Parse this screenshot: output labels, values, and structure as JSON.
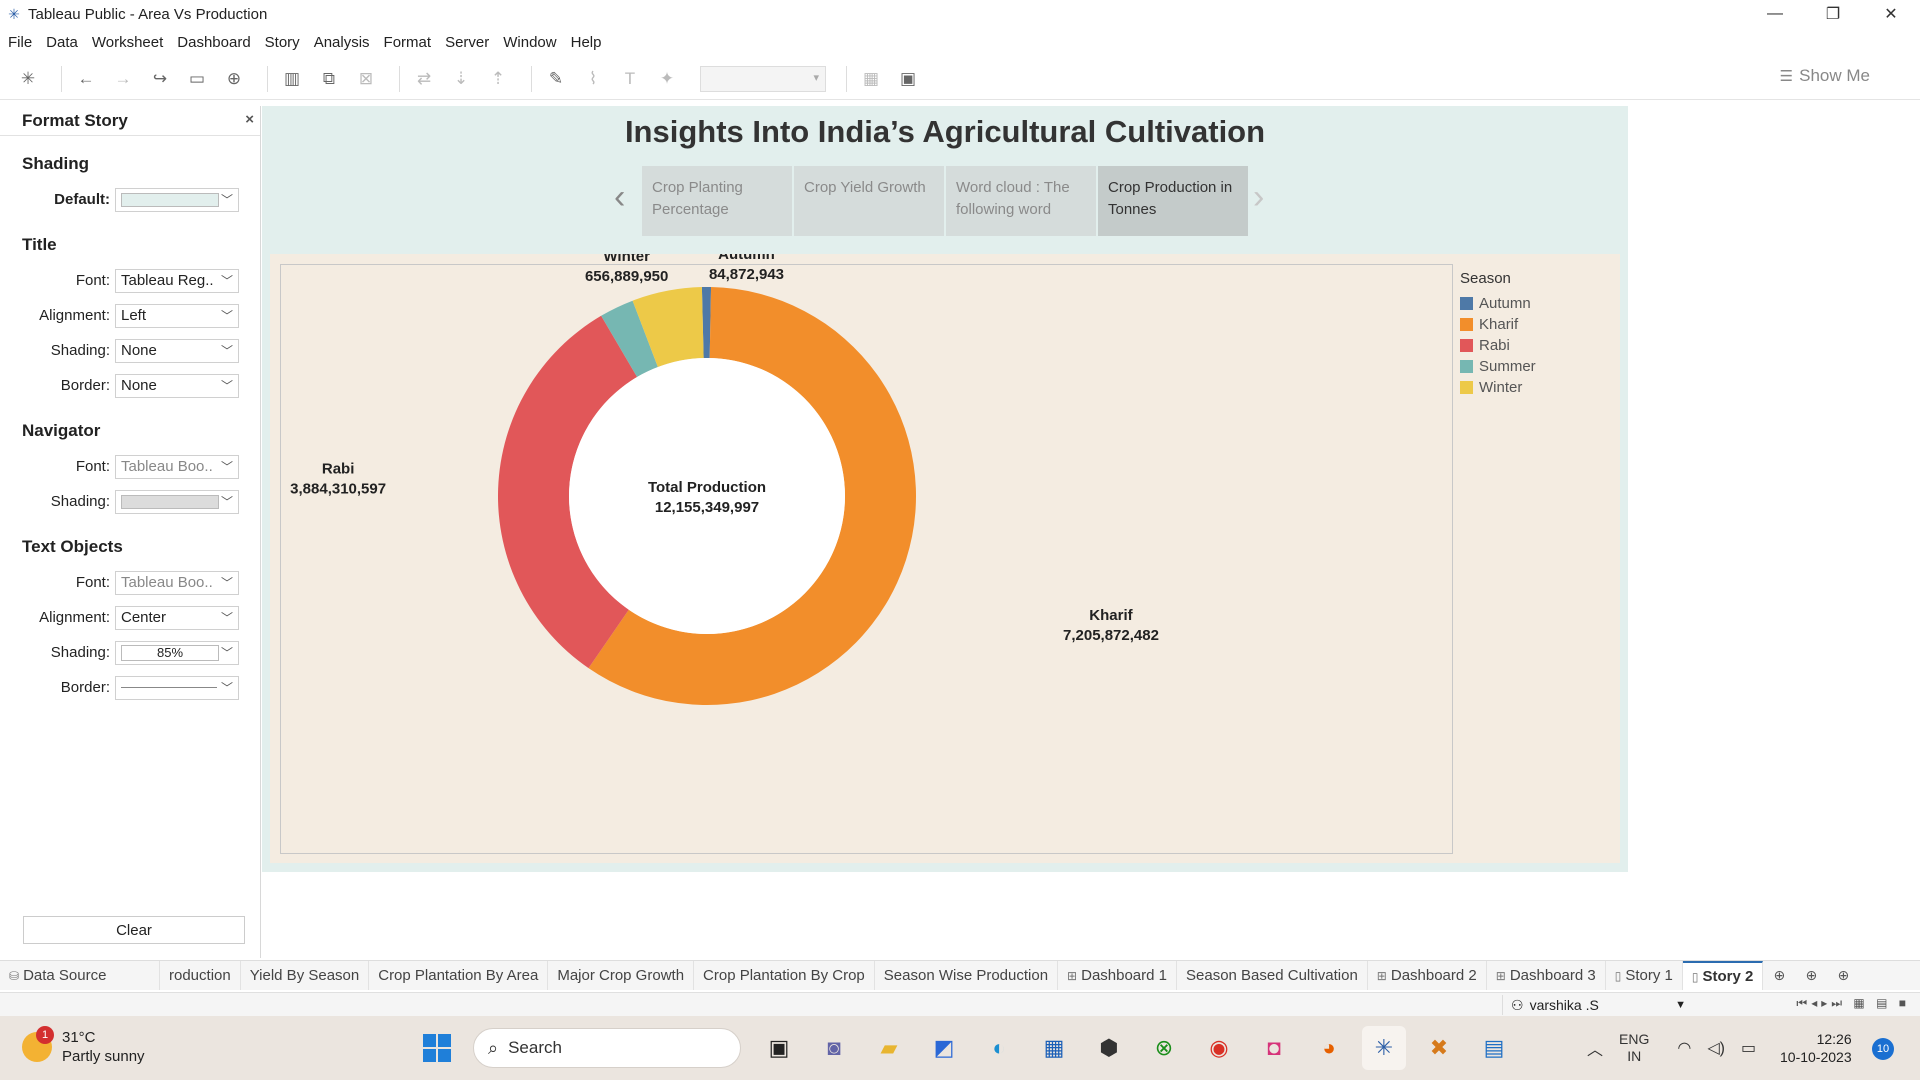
{
  "window": {
    "title": "Tableau Public - Area Vs Production"
  },
  "menu": [
    "File",
    "Data",
    "Worksheet",
    "Dashboard",
    "Story",
    "Analysis",
    "Format",
    "Server",
    "Window",
    "Help"
  ],
  "toolbar": {
    "show_me_label": "Show Me"
  },
  "format_panel": {
    "title": "Format Story",
    "shading_section": "Shading",
    "default_label": "Default:",
    "default_color": "#e2efed",
    "title_section": "Title",
    "title_font_label": "Font:",
    "title_font_value": "Tableau Reg..",
    "title_alignment_label": "Alignment:",
    "title_alignment_value": "Left",
    "title_shading_label": "Shading:",
    "title_shading_value": "None",
    "title_border_label": "Border:",
    "title_border_value": "None",
    "navigator_section": "Navigator",
    "nav_font_label": "Font:",
    "nav_font_value": "Tableau Boo..",
    "nav_shading_label": "Shading:",
    "nav_shading_color": "#dcdcdc",
    "text_objects_section": "Text Objects",
    "to_font_label": "Font:",
    "to_font_value": "Tableau Boo..",
    "to_alignment_label": "Alignment:",
    "to_alignment_value": "Center",
    "to_shading_label": "Shading:",
    "to_shading_value": "85%",
    "to_border_label": "Border:",
    "clear_label": "Clear"
  },
  "story": {
    "title": "Insights Into India’s Agricultural Cultivation",
    "points": [
      "Crop Planting Percentage",
      "Crop Yield Growth",
      "Word cloud : The following word",
      "Crop Production in Tonnes"
    ],
    "active_point": 3
  },
  "chart_data": {
    "type": "pie",
    "donut": true,
    "center_label": "Total Production",
    "center_value": "12,155,349,997",
    "legend_title": "Season",
    "legend_position": "top-right",
    "categories": [
      "Autumn",
      "Kharif",
      "Rabi",
      "Summer",
      "Winter"
    ],
    "values": [
      84872943,
      7205872482,
      3884310597,
      323404025,
      656889950
    ],
    "value_labels": [
      "84,872,943",
      "7,205,872,482",
      "3,884,310,597",
      "",
      "656,889,950"
    ],
    "colors": [
      "#4e79a7",
      "#f28e2b",
      "#e15759",
      "#76b7b2",
      "#edc948"
    ],
    "start_angle_deg": -1.4
  },
  "sheet_tabs": [
    {
      "label": "Data Source",
      "icon": "database-icon"
    },
    {
      "label": "roduction",
      "icon": ""
    },
    {
      "label": "Yield By Season",
      "icon": ""
    },
    {
      "label": "Crop Plantation By Area",
      "icon": ""
    },
    {
      "label": "Major Crop Growth",
      "icon": ""
    },
    {
      "label": "Crop Plantation By Crop",
      "icon": ""
    },
    {
      "label": "Season Wise Production",
      "icon": ""
    },
    {
      "label": "Dashboard 1",
      "icon": "dashboard-icon"
    },
    {
      "label": "Season Based Cultivation",
      "icon": ""
    },
    {
      "label": "Dashboard 2",
      "icon": "dashboard-icon"
    },
    {
      "label": "Dashboard 3",
      "icon": "dashboard-icon"
    },
    {
      "label": "Story 1",
      "icon": "story-icon"
    },
    {
      "label": "Story 2",
      "icon": "story-icon"
    }
  ],
  "status": {
    "user": "varshika .S"
  },
  "taskbar": {
    "weather_temp": "31°C",
    "weather_desc": "Partly sunny",
    "weather_badge": "1",
    "search_placeholder": "Search",
    "lang_top": "ENG",
    "lang_bottom": "IN",
    "time": "12:26",
    "date": "10-10-2023",
    "notifications": "10"
  }
}
